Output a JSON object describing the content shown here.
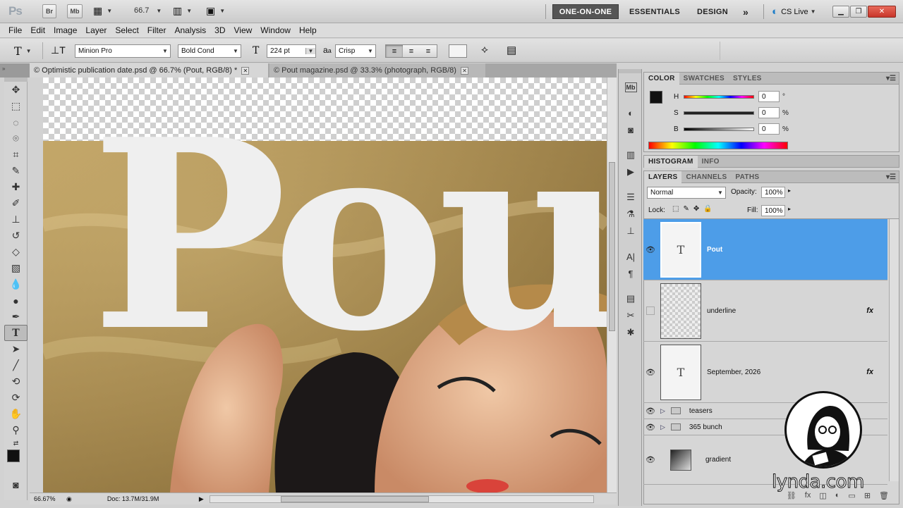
{
  "app": {
    "logo": "Ps",
    "bridge": "Br",
    "mini_bridge": "Mb",
    "zoom": "66.7",
    "workspaces": [
      "ONE-ON-ONE",
      "ESSENTIALS",
      "DESIGN"
    ],
    "more_workspaces": "»",
    "cs_live": "CS Live"
  },
  "menu": [
    "File",
    "Edit",
    "Image",
    "Layer",
    "Select",
    "Filter",
    "Analysis",
    "3D",
    "View",
    "Window",
    "Help"
  ],
  "options": {
    "font_family": "Minion Pro",
    "font_style": "Bold Cond",
    "font_size": "224 pt",
    "aa_label": "a",
    "aa_method": "Crisp"
  },
  "tabs": [
    {
      "label": "© Optimistic publication date.psd @ 66.7% (Pout, RGB/8) *"
    },
    {
      "label": "© Pout magazine.psd @ 33.3% (photograph, RGB/8)"
    }
  ],
  "canvas": {
    "headline": "Pou"
  },
  "status": {
    "zoom": "66.67%",
    "doc": "Doc: 13.7M/31.9M"
  },
  "color_panel": {
    "tabs": [
      "COLOR",
      "SWATCHES",
      "STYLES"
    ],
    "h_label": "H",
    "h_value": "0",
    "h_unit": "°",
    "s_label": "S",
    "s_value": "0",
    "s_unit": "%",
    "b_label": "B",
    "b_value": "0",
    "b_unit": "%"
  },
  "histogram_panel": {
    "tabs": [
      "HISTOGRAM",
      "INFO"
    ]
  },
  "layers_panel": {
    "tabs": [
      "LAYERS",
      "CHANNELS",
      "PATHS"
    ],
    "blend_mode": "Normal",
    "opacity_label": "Opacity:",
    "opacity_value": "100%",
    "lock_label": "Lock:",
    "fill_label": "Fill:",
    "fill_value": "100%",
    "layers": [
      {
        "name": "Pout",
        "thumb": "T"
      },
      {
        "name": "underline",
        "fx": "fx"
      },
      {
        "name": "September, 2026",
        "thumb": "T",
        "fx": "fx"
      },
      {
        "name": "teasers"
      },
      {
        "name": "365 bunch"
      },
      {
        "name": "gradient"
      }
    ]
  },
  "watermark": "lynda.com",
  "colors": {
    "selected_layer": "#4d9de8",
    "workspace_active": "#555555",
    "text_fill": "#efefef"
  }
}
